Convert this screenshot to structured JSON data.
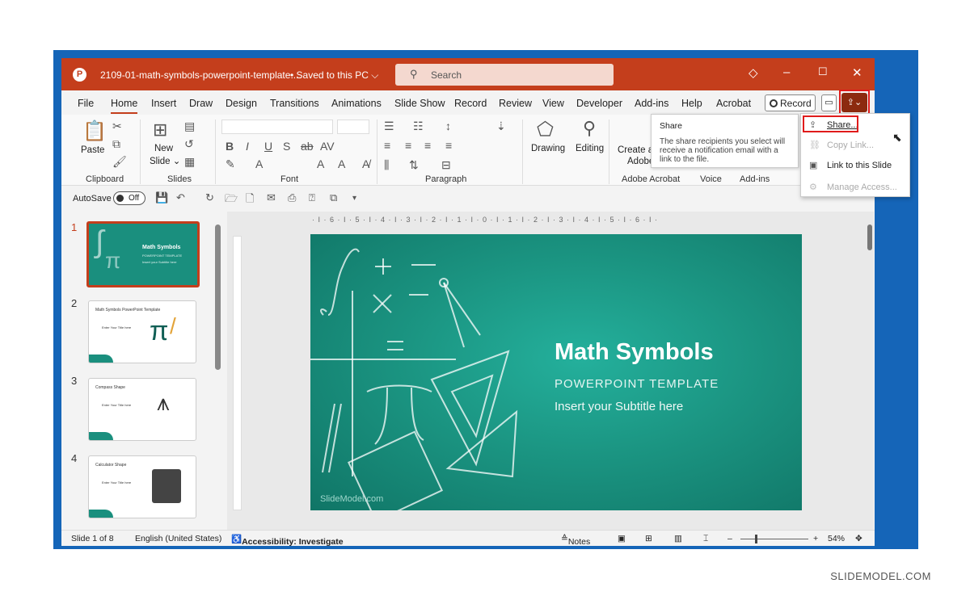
{
  "titlebar": {
    "filename": "2109-01-math-symbols-powerpoint-template....",
    "saved": "• Saved to this PC ⌵",
    "search_placeholder": "Search",
    "icons": [
      "diamond-icon",
      "minimize-icon",
      "maximize-icon",
      "close-icon"
    ]
  },
  "menu": {
    "tabs": [
      "File",
      "Home",
      "Insert",
      "Draw",
      "Design",
      "Transitions",
      "Animations",
      "Slide Show",
      "Record",
      "Review",
      "View",
      "Developer",
      "Add-ins",
      "Help",
      "Acrobat"
    ],
    "active": "Home",
    "record_label": "Record"
  },
  "ribbon": {
    "paste": "Paste",
    "new_slide": "New",
    "new_slide2": "Slide ⌄",
    "drawing": "Drawing",
    "editing": "Editing",
    "create": "Create a",
    "adobe": "Adobe",
    "groups": [
      "Clipboard",
      "Slides",
      "Font",
      "Paragraph",
      "Adobe Acrobat",
      "Voice",
      "Add-ins"
    ]
  },
  "quickaccess": {
    "autosave": "AutoSave",
    "toggle": "Off"
  },
  "thumbnails": [
    {
      "num": "1",
      "title": "Math Symbols",
      "sub": "POWERPOINT TEMPLATE",
      "sub2": "Insert your Subtitle here"
    },
    {
      "num": "2",
      "title": "Math Symbols PowerPoint Template",
      "sub": "Enter Your Title here"
    },
    {
      "num": "3",
      "title": "Compass Shape",
      "sub": "Enter Your Title here"
    },
    {
      "num": "4",
      "title": "Calculator Shape",
      "sub": "Enter Your Title here"
    }
  ],
  "ruler": "· I · 6 · I · 5 · I · 4 · I · 3 · I · 2 · I · 1 · I · 0 · I · 1 · I · 2 · I · 3 · I · 4 · I · 5 · I · 6 · I ·",
  "slide": {
    "title": "Math Symbols",
    "subtitle": "POWERPOINT TEMPLATE",
    "tagline": "Insert your Subtitle here",
    "watermark": "SlideModel.com"
  },
  "status": {
    "slide_count": "Slide 1 of 8",
    "language": "English (United States)",
    "accessibility": "Accessibility: Investigate",
    "notes": "Notes",
    "zoom": "54%"
  },
  "tooltip": {
    "title": "Share",
    "body": "The share recipients you select will receive a notification email with a link to the file."
  },
  "share_menu": {
    "items": [
      {
        "label": "Share...",
        "enabled": true
      },
      {
        "label": "Copy Link...",
        "enabled": false
      },
      {
        "label": "Link to this Slide",
        "enabled": true
      },
      {
        "label": "Manage Access...",
        "enabled": false
      }
    ]
  },
  "footer": "SLIDEMODEL.COM",
  "colors": {
    "accent": "#c43e1c",
    "slide": "#1b9582",
    "highlight": "#e01b1b"
  }
}
